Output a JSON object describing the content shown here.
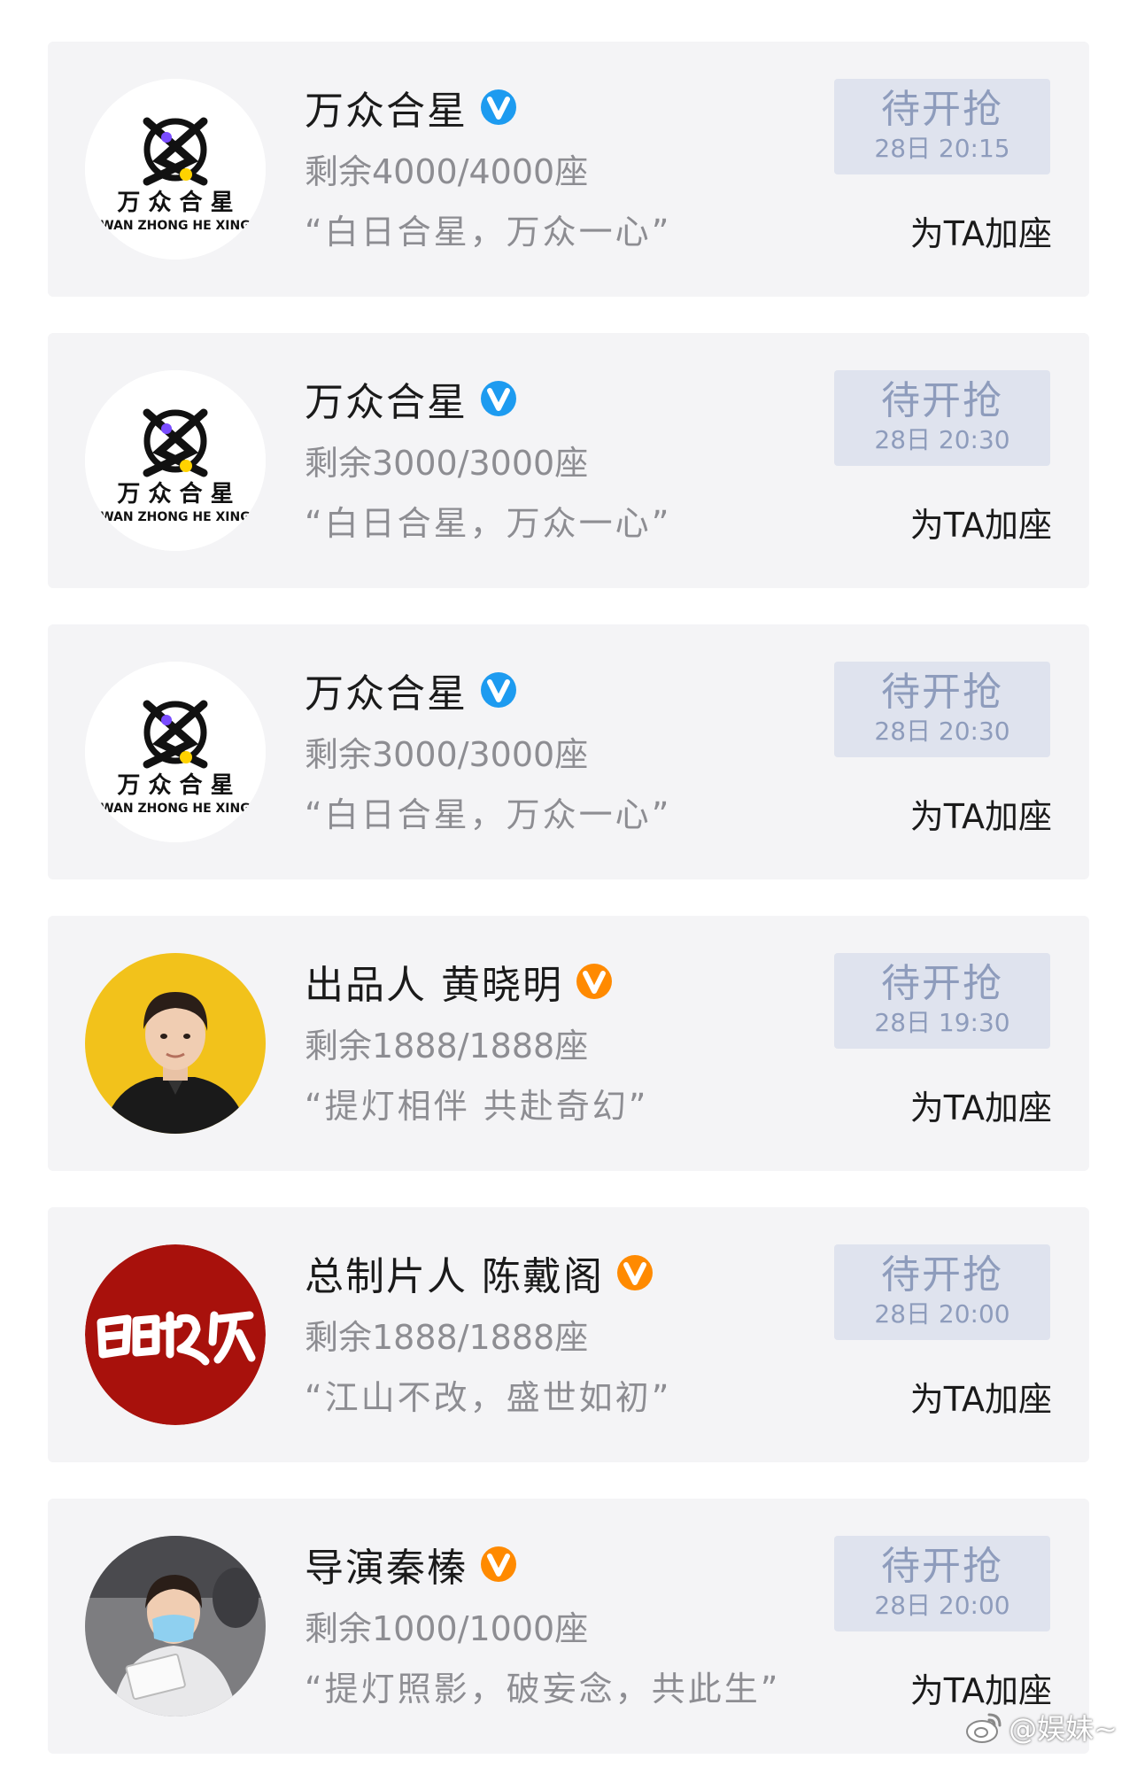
{
  "entries": [
    {
      "name": "万众合星",
      "verify_color": "#1d9bf0",
      "avatar": "wanzhong-logo",
      "seats": "剩余4000/4000座",
      "slogan": "“白日合星，万众一心”",
      "status_label": "待开抢",
      "status_time": "28日 20:15",
      "action": "为TA加座"
    },
    {
      "name": "万众合星",
      "verify_color": "#1d9bf0",
      "avatar": "wanzhong-logo",
      "seats": "剩余3000/3000座",
      "slogan": "“白日合星，万众一心”",
      "status_label": "待开抢",
      "status_time": "28日 20:30",
      "action": "为TA加座"
    },
    {
      "name": "万众合星",
      "verify_color": "#1d9bf0",
      "avatar": "wanzhong-logo",
      "seats": "剩余3000/3000座",
      "slogan": "“白日合星，万众一心”",
      "status_label": "待开抢",
      "status_time": "28日 20:30",
      "action": "为TA加座"
    },
    {
      "name": "出品人 黄晓明",
      "verify_color": "#ff8a00",
      "avatar": "person-photo-yellow",
      "seats": "剩余1888/1888座",
      "slogan": "“提灯相伴 共赴奇幻”",
      "status_label": "待开抢",
      "status_time": "28日 19:30",
      "action": "为TA加座"
    },
    {
      "name": "总制片人 陈戴阁",
      "verify_color": "#ff8a00",
      "avatar": "baoridengdeng-calligraphy-logo",
      "seats": "剩余1888/1888座",
      "slogan": "“江山不改，盛世如初”",
      "status_label": "待开抢",
      "status_time": "28日 20:00",
      "action": "为TA加座"
    },
    {
      "name": "导演秦榛",
      "verify_color": "#ff8a00",
      "avatar": "person-photo-reading",
      "seats": "剩余1000/1000座",
      "slogan": "“提灯照影，破妄念，共此生”",
      "status_label": "待开抢",
      "status_time": "28日 20:00",
      "action": "为TA加座"
    }
  ],
  "watermark": {
    "icon": "weibo-icon",
    "text": "@娱妹~"
  }
}
